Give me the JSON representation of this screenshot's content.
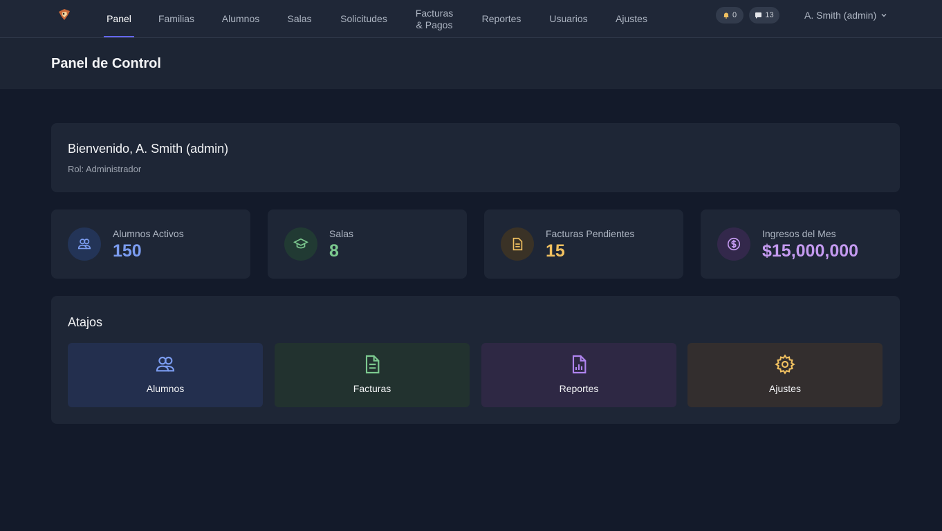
{
  "nav": {
    "logo_name": "app-logo",
    "items": [
      {
        "label": "Panel",
        "active": true
      },
      {
        "label": "Familias"
      },
      {
        "label": "Alumnos"
      },
      {
        "label": "Salas"
      },
      {
        "label": "Solicitudes"
      },
      {
        "label": "Facturas\n& Pagos"
      },
      {
        "label": "Reportes"
      },
      {
        "label": "Usuarios"
      },
      {
        "label": "Ajustes"
      }
    ],
    "notifications": {
      "icon": "bell-icon",
      "count": "0"
    },
    "messages": {
      "icon": "chat-icon",
      "count": "13"
    },
    "user": {
      "label": "A. Smith (admin)",
      "icon": "chevron-down-icon"
    }
  },
  "header": {
    "title": "Panel de Control"
  },
  "welcome": {
    "title": "Bienvenido, A. Smith (admin)",
    "role": "Rol: Administrador"
  },
  "stats": [
    {
      "label": "Alumnos Activos",
      "value": "150",
      "icon": "users-icon",
      "color": "#7b9cf0",
      "bg": "#233457"
    },
    {
      "label": "Salas",
      "value": "8",
      "icon": "graduation-cap-icon",
      "color": "#7cc98f",
      "bg": "#213a33"
    },
    {
      "label": "Facturas Pendientes",
      "value": "15",
      "icon": "document-icon",
      "color": "#f0c060",
      "bg": "#3a3226"
    },
    {
      "label": "Ingresos del Mes",
      "value": "$15,000,000",
      "icon": "dollar-icon",
      "color": "#c49af0",
      "bg": "#33284b"
    }
  ],
  "shortcuts": {
    "title": "Atajos",
    "items": [
      {
        "label": "Alumnos",
        "icon": "users-icon",
        "color": "#7b9cf0",
        "bg": "#232f4e"
      },
      {
        "label": "Facturas",
        "icon": "document-icon",
        "color": "#7cc98f",
        "bg": "#22322f"
      },
      {
        "label": "Reportes",
        "icon": "report-icon",
        "color": "#b084f0",
        "bg": "#2e2844"
      },
      {
        "label": "Ajustes",
        "icon": "gear-icon",
        "color": "#f0c060",
        "bg": "#332e2e"
      }
    ]
  }
}
